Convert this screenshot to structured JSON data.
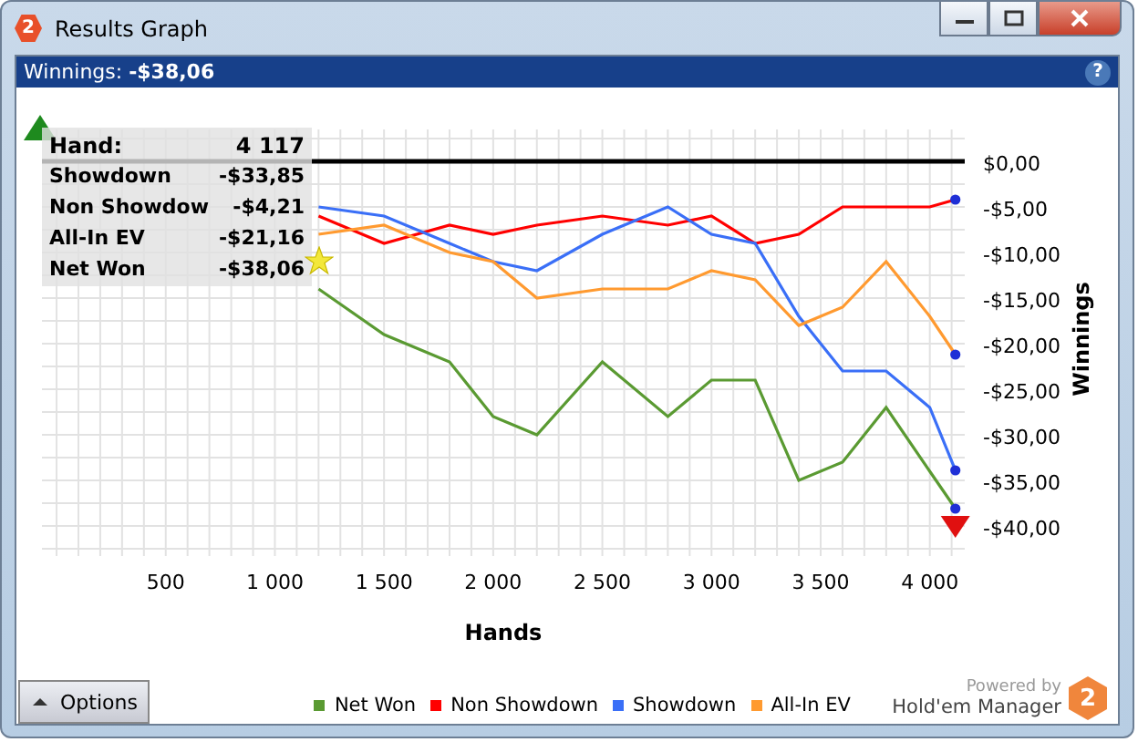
{
  "window": {
    "title": "Results Graph",
    "icon_text": "2"
  },
  "header": {
    "label": "Winnings:",
    "value": "-$38,06",
    "help": "?"
  },
  "chart": {
    "chart_data": {
      "type": "line",
      "xlabel": "Hands",
      "ylabel": "Winnings",
      "x": [
        1200,
        1500,
        1800,
        2000,
        2200,
        2500,
        2800,
        3000,
        3200,
        3400,
        3600,
        3800,
        4000,
        4117
      ],
      "series": [
        {
          "name": "Net Won",
          "color": "#5a9a32",
          "values": [
            -14,
            -19,
            -22,
            -28,
            -30,
            -22,
            -28,
            -24,
            -24,
            -35,
            -33,
            -27,
            -34,
            -38.1
          ]
        },
        {
          "name": "Non Showdown",
          "color": "#ff0000",
          "values": [
            -6,
            -9,
            -7,
            -8,
            -7,
            -6,
            -7,
            -6,
            -9,
            -8,
            -5,
            -5,
            -5,
            -4.2
          ]
        },
        {
          "name": "Showdown",
          "color": "#3a6ff7",
          "values": [
            -5,
            -6,
            -9,
            -11,
            -12,
            -8,
            -5,
            -8,
            -9,
            -17,
            -23,
            -23,
            -27,
            -33.9
          ]
        },
        {
          "name": "All-In EV",
          "color": "#ff9a30",
          "values": [
            -8,
            -7,
            -10,
            -11,
            -15,
            -14,
            -14,
            -12,
            -13,
            -18,
            -16,
            -11,
            -17,
            -21.2
          ]
        }
      ],
      "grid": true,
      "xlim": [
        -67,
        4160
      ],
      "ylim": [
        -42.5,
        3.5
      ],
      "xticks": [
        {
          "value": 500,
          "label": "500"
        },
        {
          "value": 1000,
          "label": "1 000"
        },
        {
          "value": 1500,
          "label": "1 500"
        },
        {
          "value": 2000,
          "label": "2 000"
        },
        {
          "value": 2500,
          "label": "2 500"
        },
        {
          "value": 3000,
          "label": "3 000"
        },
        {
          "value": 3500,
          "label": "3 500"
        },
        {
          "value": 4000,
          "label": "4 000"
        }
      ],
      "yticks": [
        {
          "value": 0,
          "label": "$0,00"
        },
        {
          "value": -5,
          "label": "-$5,00"
        },
        {
          "value": -10,
          "label": "-$10,00"
        },
        {
          "value": -15,
          "label": "-$15,00"
        },
        {
          "value": -20,
          "label": "-$20,00"
        },
        {
          "value": -25,
          "label": "-$25,00"
        },
        {
          "value": -30,
          "label": "-$30,00"
        },
        {
          "value": -35,
          "label": "-$35,00"
        },
        {
          "value": -40,
          "label": "-$40,00"
        }
      ]
    },
    "tooltip": {
      "hand_label": "Hand:",
      "hand_value": "4 117",
      "rows": [
        {
          "label": "Showdown",
          "value": "-$33,85"
        },
        {
          "label": "Non Showdow",
          "value": "-$4,21"
        },
        {
          "label": "All-In EV",
          "value": "-$21,16"
        },
        {
          "label": "Net Won",
          "value": "-$38,06"
        }
      ]
    }
  },
  "footer": {
    "options_button": "Options",
    "powered_by": "Powered by",
    "brand": "Hold'em Manager",
    "logo_text": "2"
  }
}
